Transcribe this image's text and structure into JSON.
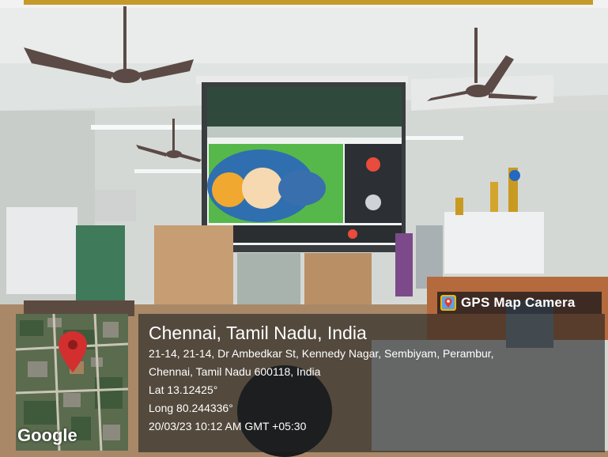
{
  "badge": {
    "label": "GPS Map Camera",
    "icon": "map-pin-app-icon"
  },
  "map": {
    "provider_label": "Google",
    "icon": "location-pin-icon"
  },
  "location": {
    "title": "Chennai, Tamil Nadu, India",
    "address_line1": "21-14, 21-14, Dr Ambedkar St, Kennedy Nagar, Sembiyam, Perambur,",
    "address_line2": "Chennai, Tamil Nadu 600118, India",
    "lat": "Lat 13.12425°",
    "long": "Long 80.244336°",
    "timestamp": "20/03/23 10:12 AM GMT +05:30"
  },
  "colors": {
    "pin": "#d32f2f",
    "overlay": "#1e2224",
    "screen_green": "#56b84a"
  }
}
